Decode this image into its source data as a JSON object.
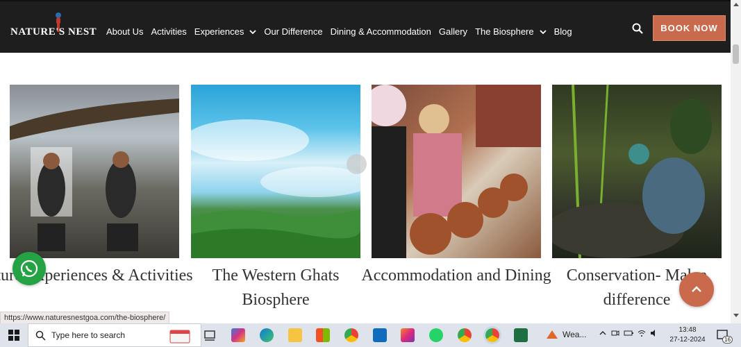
{
  "header": {
    "logo_text": "NATURE'S NEST",
    "nav": [
      {
        "label": "About Us"
      },
      {
        "label": "Activities"
      },
      {
        "label": "Experiences",
        "dropdown": true
      },
      {
        "label": "Our Difference"
      },
      {
        "label": "Dining & Accommodation"
      },
      {
        "label": "Gallery"
      },
      {
        "label": "The Biosphere",
        "dropdown": true
      },
      {
        "label": "Blog"
      }
    ],
    "book_label": "BOOK NOW",
    "accent": "#c96a4d",
    "bg": "#1e1e1e"
  },
  "cards": [
    {
      "title": "Nature Experiences & Activities",
      "visible_title": "ture Experiences & Activities"
    },
    {
      "title": "The Western Ghats Biosphere"
    },
    {
      "title": "Accommodation and Dining"
    },
    {
      "title": "Conservation- Making a difference",
      "visible_title": "Conservation- Mak a difference"
    }
  ],
  "status_url": "https://www.naturesnestgoa.com/the-biosphere/",
  "taskbar": {
    "search_placeholder": "Type here to search",
    "weather": "Wea...",
    "time": "13:48",
    "date": "27-12-2024",
    "notification_count": "16"
  }
}
